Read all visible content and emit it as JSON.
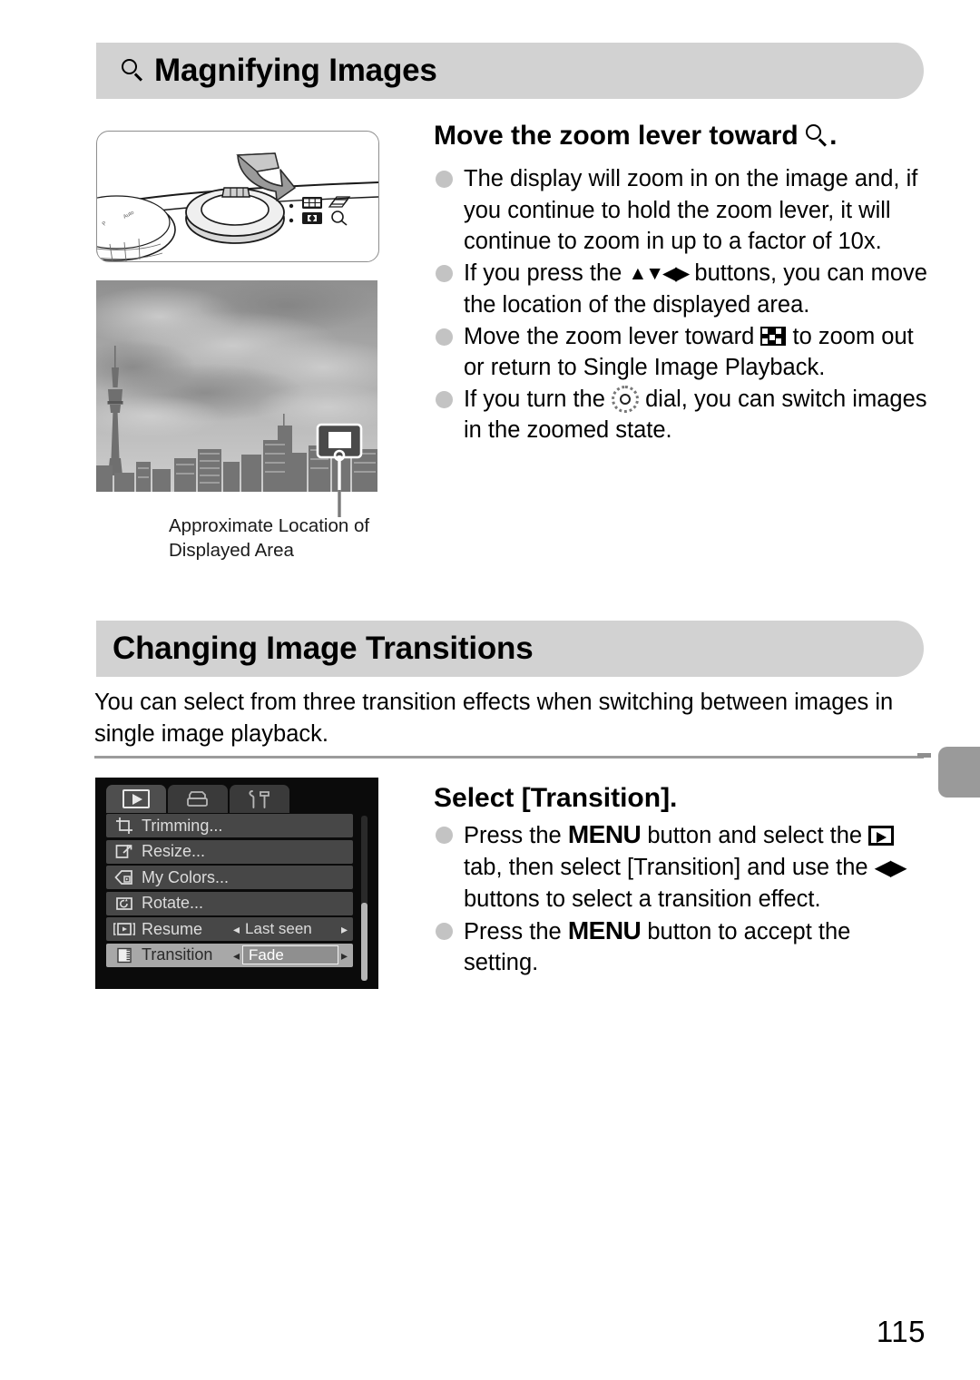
{
  "page": {
    "number": "115"
  },
  "sections": [
    {
      "id": "magnifying",
      "title": "Magnifying Images",
      "icon": "magnifier-icon",
      "step_heading_prefix": "Move the zoom lever toward",
      "step_heading_suffix": ".",
      "bullets": [
        "The display will zoom in on the image and, if you continue to hold the zoom lever, it will continue to zoom in up to a factor of 10x.",
        "If you press the ATDP buttons, you can move the location of the displayed area.",
        "Move the zoom lever toward INDEX to zoom out or return to Single Image Playback.",
        "If you turn the DIAL dial, you can switch images in the zoomed state."
      ],
      "bullet_parts": {
        "b2_pre": "If you press the ",
        "b2_post": " buttons, you can move the location of the displayed area.",
        "b3_pre": "Move the zoom lever toward ",
        "b3_post": " to zoom out or return to Single Image Playback.",
        "b4_pre": "If you turn the ",
        "b4_post": " dial, you can switch images in the zoomed state."
      },
      "figure_caption": "Approximate Location of Displayed Area"
    },
    {
      "id": "transitions",
      "title": "Changing Image Transitions",
      "intro": "You can select from three transition effects when switching between images in single image playback.",
      "step_heading": "Select [Transition].",
      "bullet_parts": {
        "b1_p1": "Press the ",
        "b1_menu": "MENU",
        "b1_p2": " button and select the ",
        "b1_p3": " tab, then select [Transition] and use the ",
        "b1_p4": " buttons to select a transition effect.",
        "b2_p1": "Press the ",
        "b2_menu": "MENU",
        "b2_p2": " button to accept the setting."
      }
    }
  ],
  "camera_menu": {
    "tabs": [
      {
        "name": "playback-tab",
        "icon": "play-icon",
        "active": true
      },
      {
        "name": "print-tab",
        "icon": "printer-icon",
        "active": false
      },
      {
        "name": "settings-tab",
        "icon": "wrench-hammer-icon",
        "active": false
      }
    ],
    "rows": [
      {
        "icon": "trimming-icon",
        "label": "Trimming...",
        "value": "",
        "selected": false
      },
      {
        "icon": "resize-icon",
        "label": "Resize...",
        "value": "",
        "selected": false
      },
      {
        "icon": "my-colors-icon",
        "label": "My Colors...",
        "value": "",
        "selected": false
      },
      {
        "icon": "rotate-icon",
        "label": "Rotate...",
        "value": "",
        "selected": false
      },
      {
        "icon": "resume-icon",
        "label": "Resume",
        "value": "Last seen",
        "selected": false
      },
      {
        "icon": "transition-icon",
        "label": "Transition",
        "value": "Fade",
        "selected": true
      }
    ],
    "arrow_left": "◂",
    "arrow_right": "▸"
  },
  "colors": {
    "heading_bar": "#d2d2d2",
    "bullet": "#c3c3c3",
    "divider": "#9b9b9b",
    "thumb_tab": "#9a9a9a",
    "menu_bg": "#0b0b0b",
    "menu_row": "#474747",
    "menu_row_selected": "#a8a8a8"
  }
}
